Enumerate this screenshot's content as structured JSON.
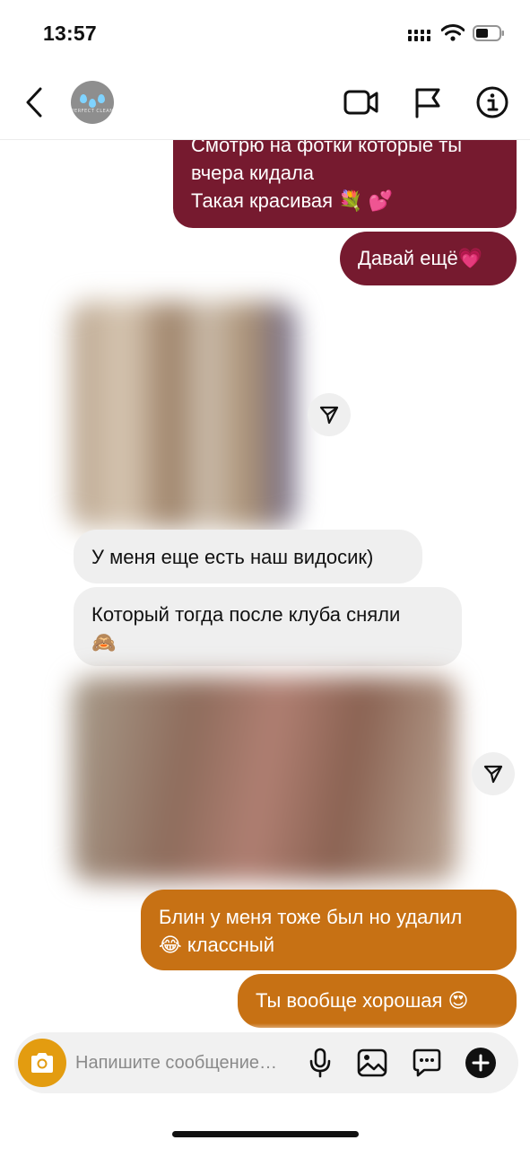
{
  "status_bar": {
    "time": "13:57"
  },
  "header": {
    "avatar_brand": "PERFECT CLEAN"
  },
  "messages": {
    "out1_line1": "Смотрю на фотки которые ты",
    "out1_line2": "вчера кидала",
    "out1_line3": "Такая красивая 💐 💕",
    "out2": "Давай ещё💗",
    "in1": "У меня еще есть наш видосик)",
    "in2_line1": "Который тогда после клуба сняли",
    "in2_line2": "🙈",
    "out3_line1": "Блин у меня тоже был но удалил",
    "out3_line2": "😂 классный",
    "out4": "Ты вообще хорошая 😍"
  },
  "composer": {
    "placeholder": "Напишите сообщение…"
  },
  "colors": {
    "outgoing_red": "#761a2f",
    "outgoing_orange": "#c77114",
    "incoming": "#efefef",
    "camera_button": "#e39c10"
  },
  "icons": [
    "back-icon",
    "video-call-icon",
    "flag-icon",
    "info-icon",
    "share-icon",
    "camera-icon",
    "microphone-icon",
    "gallery-icon",
    "sticker-icon",
    "plus-icon"
  ]
}
